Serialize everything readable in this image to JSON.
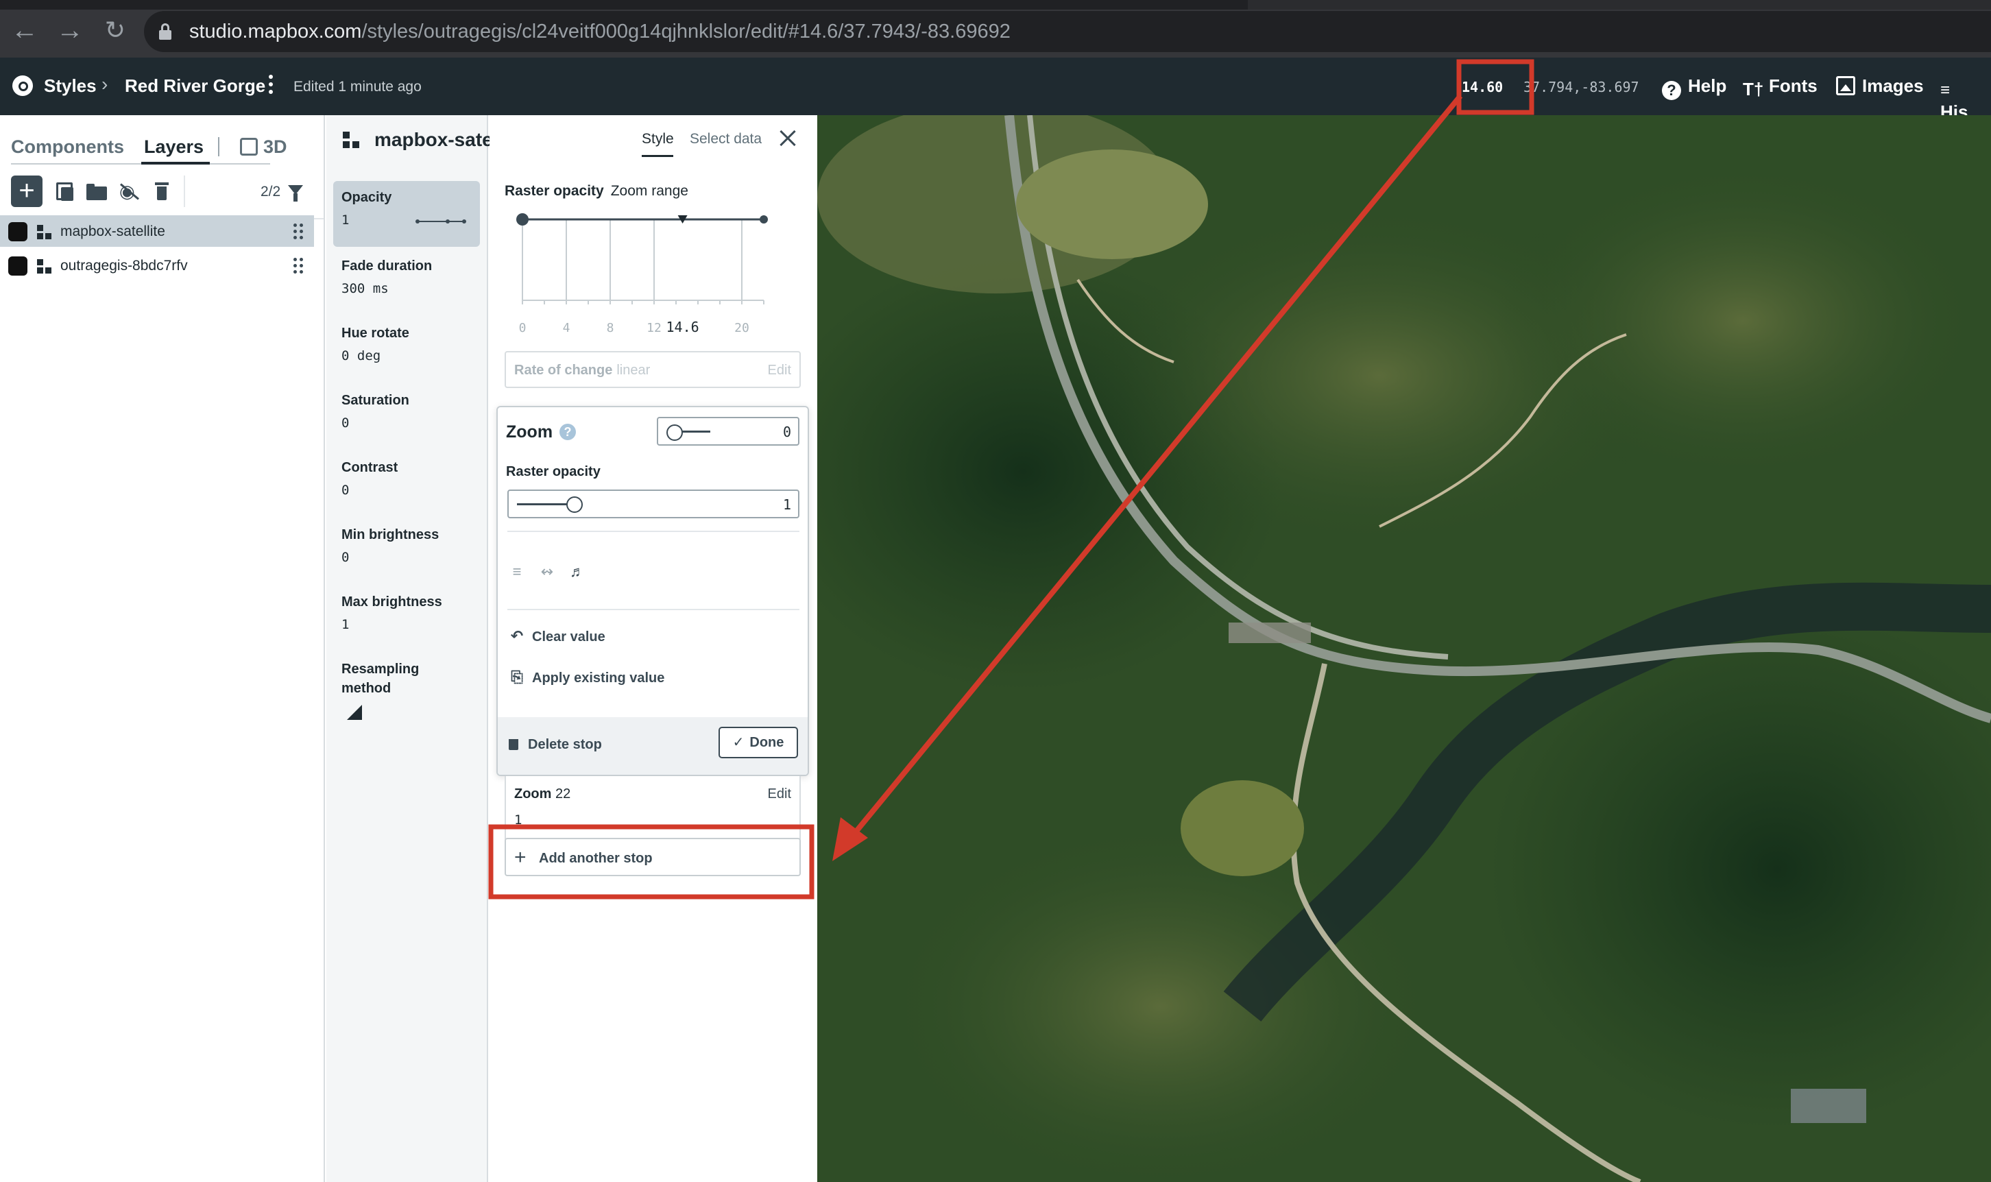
{
  "browser": {
    "url_domain": "studio.mapbox.com",
    "url_path": "/styles/outragegis/cl24veitf000g14qjhnklslor/edit/#14.6/37.7943/-83.69692"
  },
  "topbar": {
    "styles_label": "Styles",
    "style_name": "Red River Gorge",
    "edited": "Edited 1 minute ago",
    "zoom_readout": "14.60",
    "coords_readout": "37.794,-83.697",
    "help": "Help",
    "fonts": "Fonts",
    "images": "Images",
    "history": "His"
  },
  "layers_panel": {
    "tabs": {
      "components": "Components",
      "layers": "Layers",
      "three_d": "3D"
    },
    "count": "2/2",
    "layers": [
      {
        "name": "mapbox-satellite"
      },
      {
        "name": "outragegis-8bdc7rfv"
      }
    ]
  },
  "properties": {
    "layer_title": "mapbox-satellite",
    "tabs": {
      "style": "Style",
      "select_data": "Select data"
    },
    "items": [
      {
        "label": "Opacity",
        "value": "1"
      },
      {
        "label": "Fade duration",
        "value": "300 ms"
      },
      {
        "label": "Hue rotate",
        "value": "0 deg"
      },
      {
        "label": "Saturation",
        "value": "0"
      },
      {
        "label": "Contrast",
        "value": "0"
      },
      {
        "label": "Min brightness",
        "value": "0"
      },
      {
        "label": "Max brightness",
        "value": "1"
      },
      {
        "label": "Resampling method",
        "value": ""
      }
    ]
  },
  "editor": {
    "heading": "Raster opacity",
    "subheading": "Zoom range",
    "chart": {
      "ticks": [
        "0",
        "4",
        "8",
        "12",
        "20"
      ],
      "current_zoom": "14.6",
      "x_range": [
        0,
        22
      ],
      "stops": [
        0,
        22
      ]
    },
    "rate_label": "Rate of change",
    "rate_value": "linear",
    "rate_edit": "Edit",
    "stop_card": {
      "zoom_label": "Zoom",
      "zoom_value": "0",
      "raster_label": "Raster opacity",
      "raster_value": "1",
      "clear_value": "Clear value",
      "apply_existing": "Apply existing value",
      "delete_stop": "Delete stop",
      "done": "Done"
    },
    "next_stop": {
      "label": "Zoom",
      "zoom": "22",
      "value": "1",
      "edit": "Edit"
    },
    "add_stop": "Add another stop"
  },
  "colors": {
    "annotation": "#d23a2a",
    "app_bar": "#1f2a30",
    "selected_row": "#c9d3da"
  }
}
